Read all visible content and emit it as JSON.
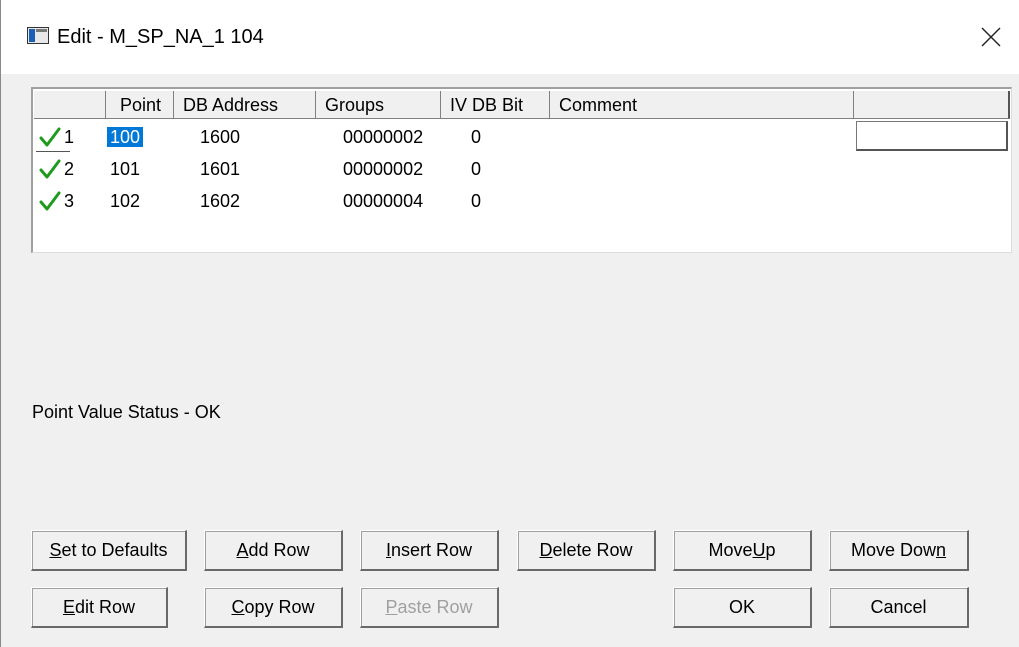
{
  "window": {
    "title": "Edit - M_SP_NA_1 104"
  },
  "grid": {
    "headers": [
      "",
      "Point",
      "DB Address",
      "Groups",
      "IV DB Bit",
      "Comment",
      ""
    ],
    "rows": [
      {
        "num": "1",
        "point": "100",
        "db_address": "1600",
        "groups": "00000002",
        "iv_db_bit": "0",
        "comment": ""
      },
      {
        "num": "2",
        "point": "101",
        "db_address": "1601",
        "groups": "00000002",
        "iv_db_bit": "0",
        "comment": ""
      },
      {
        "num": "3",
        "point": "102",
        "db_address": "1602",
        "groups": "00000004",
        "iv_db_bit": "0",
        "comment": ""
      }
    ]
  },
  "status": "Point Value Status - OK",
  "buttons": {
    "set_defaults": {
      "pre": "",
      "key": "S",
      "post": "et to Defaults"
    },
    "add_row": {
      "pre": "",
      "key": "A",
      "post": "dd Row"
    },
    "insert_row": {
      "pre": "",
      "key": "I",
      "post": "nsert Row"
    },
    "delete_row": {
      "pre": "",
      "key": "D",
      "post": "elete Row"
    },
    "move_up": {
      "pre": "Move ",
      "key": "U",
      "post": "p"
    },
    "move_down": {
      "pre": "Move Dow",
      "key": "n",
      "post": ""
    },
    "edit_row": {
      "pre": "",
      "key": "E",
      "post": "dit Row"
    },
    "copy_row": {
      "pre": "",
      "key": "C",
      "post": "opy Row"
    },
    "paste_row": {
      "pre": "",
      "key": "P",
      "post": "aste Row"
    },
    "ok": {
      "pre": "OK",
      "key": "",
      "post": ""
    },
    "cancel": {
      "pre": "Cancel",
      "key": "",
      "post": ""
    }
  },
  "colors": {
    "selection": "#0078d7",
    "check": "#1f9a1f",
    "dialog_bg": "#f0f0f0"
  }
}
